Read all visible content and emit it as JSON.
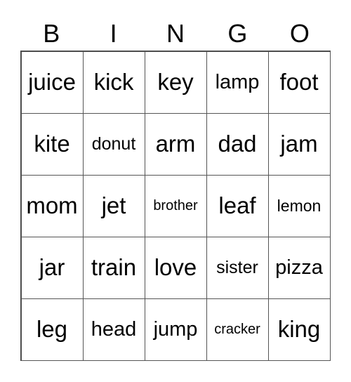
{
  "header": [
    "B",
    "I",
    "N",
    "G",
    "O"
  ],
  "cells": [
    [
      "juice",
      "kick",
      "key",
      "lamp",
      "foot"
    ],
    [
      "kite",
      "donut",
      "arm",
      "dad",
      "jam"
    ],
    [
      "mom",
      "jet",
      "brother",
      "leaf",
      "lemon"
    ],
    [
      "jar",
      "train",
      "love",
      "sister",
      "pizza"
    ],
    [
      "leg",
      "head",
      "jump",
      "cracker",
      "king"
    ]
  ]
}
